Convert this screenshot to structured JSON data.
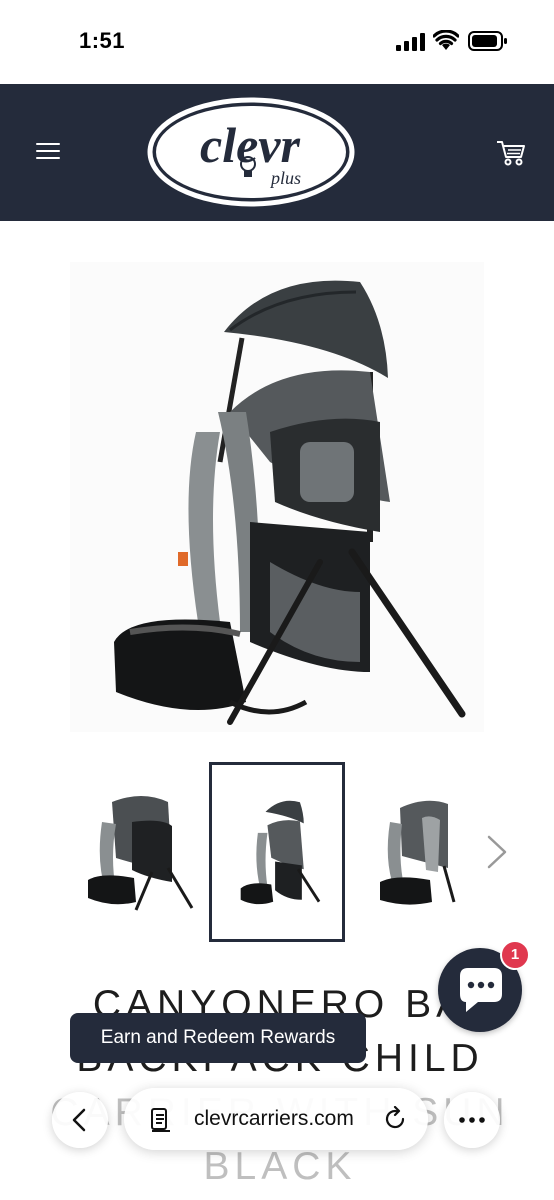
{
  "status_bar": {
    "time": "1:51"
  },
  "header": {
    "logo_text": "clevr",
    "logo_sub": "plus",
    "menu_icon": "hamburger-icon",
    "cart_icon": "cart-icon"
  },
  "product": {
    "title_line1": "CANYONERO BA",
    "title_line2": "BACKPACK CHILD",
    "title_line3": "CARRIER WITH SUN",
    "title_line4": "BLACK"
  },
  "chat": {
    "badge_count": "1"
  },
  "rewards": {
    "label": "Earn and Redeem Rewards"
  },
  "browser": {
    "url": "clevrcarriers.com"
  },
  "colors": {
    "navy": "#242b3b",
    "badge_red": "#e0384f"
  }
}
